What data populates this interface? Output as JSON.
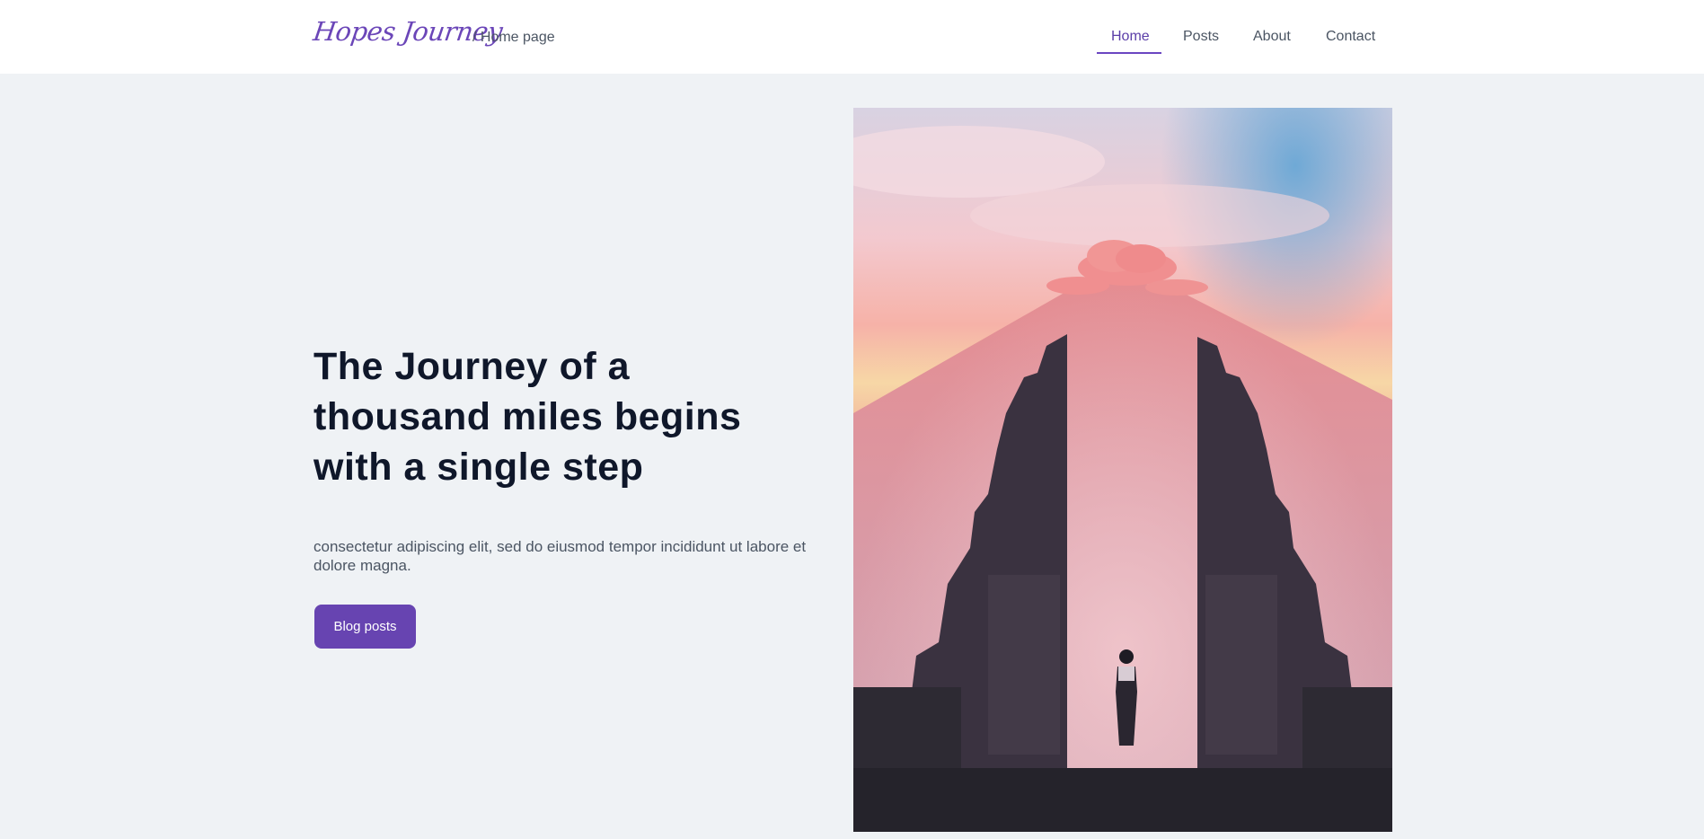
{
  "header": {
    "logo": "Hopes Journey",
    "breadcrumb": "/ Home page",
    "nav": [
      {
        "label": "Home",
        "active": true
      },
      {
        "label": "Posts",
        "active": false
      },
      {
        "label": "About",
        "active": false
      },
      {
        "label": "Contact",
        "active": false
      }
    ]
  },
  "hero": {
    "headline": "The Journey of a thousand miles begins with a single step",
    "body": "consectetur adipiscing elit, sed do eiusmod tempor incididunt ut labore et dolore magna.",
    "cta_label": "Blog posts",
    "image_subject": "temple-gate-volcano-sunset-photo"
  },
  "colors": {
    "accent": "#6744b1",
    "background": "#eff2f5",
    "heading": "#0f172a",
    "text": "#4b5563"
  }
}
